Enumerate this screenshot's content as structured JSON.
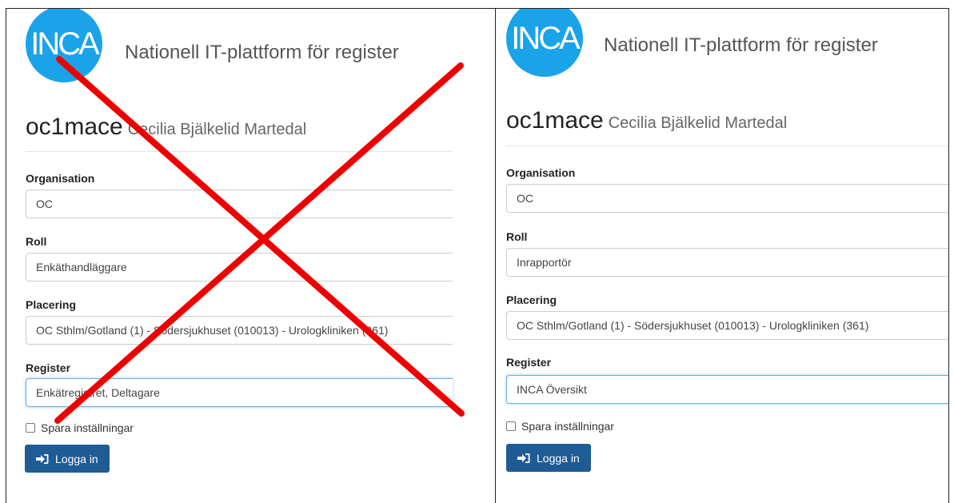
{
  "panels": {
    "left": {
      "logo_text": "INCA",
      "platform_title": "Nationell IT-plattform för register",
      "user_id": "oc1mace",
      "user_name": "Cecilia Bjälkelid Martedal",
      "organisation": {
        "label": "Organisation",
        "value": "OC"
      },
      "role": {
        "label": "Roll",
        "value": "Enkäthandläggare"
      },
      "placement": {
        "label": "Placering",
        "value": "OC Sthlm/Gotland (1) - Södersjukhuset (010013) - Urologkliniken (361)"
      },
      "register": {
        "label": "Register",
        "value": "Enkätregistret, Deltagare"
      },
      "remember_label": "Spara inställningar",
      "login_label": "Logga in",
      "crossed_out": true,
      "cross_color": "#ee0000"
    },
    "right": {
      "logo_text": "INCA",
      "platform_title": "Nationell IT-plattform för register",
      "user_id": "oc1mace",
      "user_name": "Cecilia Bjälkelid Martedal",
      "organisation": {
        "label": "Organisation",
        "value": "OC"
      },
      "role": {
        "label": "Roll",
        "value": "Inrapportör"
      },
      "placement": {
        "label": "Placering",
        "value": "OC Sthlm/Gotland (1) - Södersjukhuset (010013) - Urologkliniken (361)"
      },
      "register": {
        "label": "Register",
        "value": "INCA Översikt"
      },
      "remember_label": "Spara inställningar",
      "login_label": "Logga in",
      "crossed_out": false
    }
  },
  "colors": {
    "logo": "#1aa3e8",
    "button": "#1f5b94",
    "focus_border": "#66afe9"
  }
}
